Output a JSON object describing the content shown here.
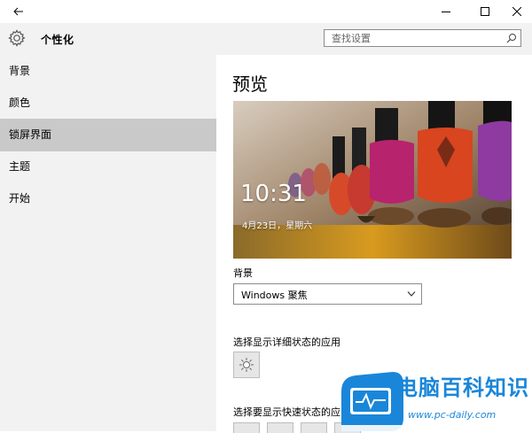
{
  "window": {
    "controls": {
      "back": "back",
      "minimize": "minimize",
      "maximize": "maximize",
      "close": "close"
    }
  },
  "header": {
    "title": "个性化",
    "search_placeholder": "查找设置"
  },
  "sidebar": {
    "items": [
      {
        "label": "背景",
        "active": false
      },
      {
        "label": "颜色",
        "active": false
      },
      {
        "label": "锁屏界面",
        "active": true
      },
      {
        "label": "主题",
        "active": false
      },
      {
        "label": "开始",
        "active": false
      }
    ]
  },
  "main": {
    "preview_title": "预览",
    "lock_time": "10:31",
    "lock_date": "4月23日，星期六",
    "background_label": "背景",
    "background_value": "Windows 聚焦",
    "detail_status_label": "选择显示详细状态的应用",
    "quick_status_label": "选择要显示快速状态的应"
  },
  "watermark": {
    "brand": "电脑百科知识",
    "url": "www.pc-daily.com"
  },
  "colors": {
    "sidebar_bg": "#f2f2f2",
    "active_item": "#c9c9c9",
    "watermark_blue": "#1a86d9"
  }
}
